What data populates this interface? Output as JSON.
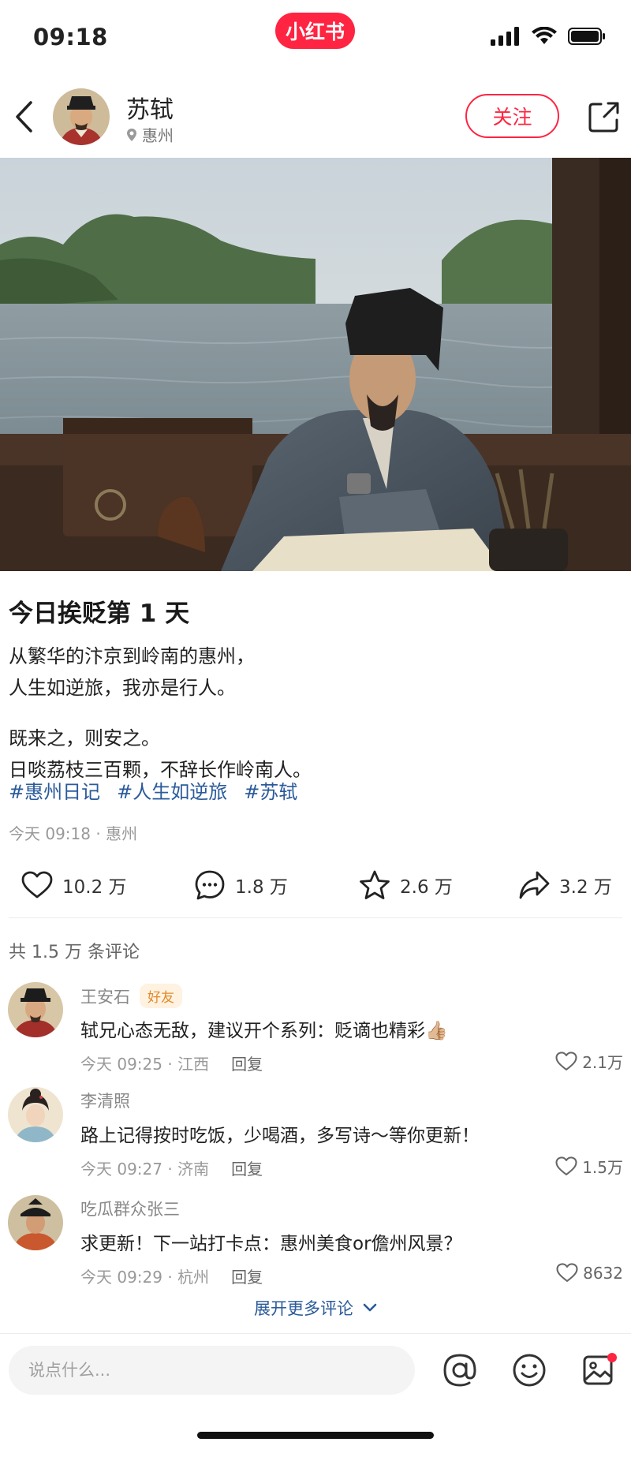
{
  "status": {
    "time": "09:18"
  },
  "app": {
    "logo_text": "小红书",
    "brand_color": "#ff2442"
  },
  "author": {
    "name": "苏轼",
    "location": "惠州",
    "follow_label": "关注"
  },
  "post": {
    "title": "今日挨贬第 1 天",
    "body": [
      "从繁华的汴京到岭南的惠州，",
      "人生如逆旅，我亦是行人。",
      "既来之，则安之。",
      "日啖荔枝三百颗，不辞长作岭南人。"
    ],
    "tags": [
      "#惠州日记",
      "#人生如逆旅",
      "#苏轼"
    ],
    "meta": "今天 09:18 · 惠州"
  },
  "actions": {
    "likes": "10.2 万",
    "comments": "1.8 万",
    "favorites": "2.6 万",
    "shares": "3.2 万"
  },
  "comments_header": "共 1.5 万 条评论",
  "comments": [
    {
      "name": "王安石",
      "badge": "好友",
      "text": "轼兄心态无敌，建议开个系列：贬谪也精彩👍🏼",
      "meta": "今天  09:25 · 江西",
      "reply": "回复",
      "likes": "2.1万"
    },
    {
      "name": "李清照",
      "text": "路上记得按时吃饭，少喝酒，多写诗～等你更新！",
      "meta": "今天  09:27 · 济南",
      "reply": "回复",
      "likes": "1.5万"
    },
    {
      "name": "吃瓜群众张三",
      "text": "求更新！下一站打卡点：惠州美食or儋州风景？",
      "meta": "今天  09:29 · 杭州",
      "reply": "回复",
      "likes": "8632"
    }
  ],
  "expand_more": "展开更多评论",
  "input": {
    "placeholder": "说点什么..."
  },
  "icons": {
    "back": "chevron-left-icon",
    "share": "share-icon",
    "like": "heart-icon",
    "comment": "comment-bubble-icon",
    "favorite": "star-icon",
    "forward": "forward-arrow-icon",
    "mention": "at-icon",
    "emoji": "emoji-icon",
    "image": "image-icon"
  }
}
